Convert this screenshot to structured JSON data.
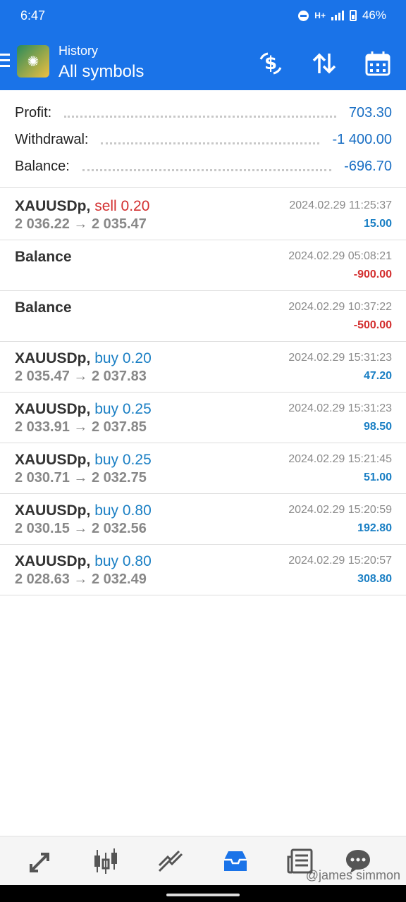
{
  "status": {
    "time": "6:47",
    "network": "H+",
    "battery": "46%"
  },
  "header": {
    "subtitle": "History",
    "title": "All symbols"
  },
  "summary": {
    "profit_label": "Profit:",
    "profit_value": "703.30",
    "withdrawal_label": "Withdrawal:",
    "withdrawal_value": "-1 400.00",
    "balance_label": "Balance:",
    "balance_value": "-696.70"
  },
  "rows": [
    {
      "symbol": "XAUUSDp,",
      "type": "sell 0.20",
      "prices": "2 036.22 → 2 035.47",
      "time": "2024.02.29 11:25:37",
      "amount": "15.00"
    },
    {
      "symbol": "Balance",
      "type": "",
      "prices": "",
      "time": "2024.02.29 05:08:21",
      "amount": "-900.00"
    },
    {
      "symbol": "Balance",
      "type": "",
      "prices": "",
      "time": "2024.02.29 10:37:22",
      "amount": "-500.00"
    },
    {
      "symbol": "XAUUSDp,",
      "type": "buy 0.20",
      "prices": "2 035.47 → 2 037.83",
      "time": "2024.02.29 15:31:23",
      "amount": "47.20"
    },
    {
      "symbol": "XAUUSDp,",
      "type": "buy 0.25",
      "prices": "2 033.91 → 2 037.85",
      "time": "2024.02.29 15:31:23",
      "amount": "98.50"
    },
    {
      "symbol": "XAUUSDp,",
      "type": "buy 0.25",
      "prices": "2 030.71 → 2 032.75",
      "time": "2024.02.29 15:21:45",
      "amount": "51.00"
    },
    {
      "symbol": "XAUUSDp,",
      "type": "buy 0.80",
      "prices": "2 030.15 → 2 032.56",
      "time": "2024.02.29 15:20:59",
      "amount": "192.80"
    },
    {
      "symbol": "XAUUSDp,",
      "type": "buy 0.80",
      "prices": "2 028.63 → 2 032.49",
      "time": "2024.02.29 15:20:57",
      "amount": "308.80"
    }
  ],
  "nav": [
    "quotes-icon",
    "chart-icon",
    "trade-icon",
    "history-icon",
    "news-icon",
    "chat-icon"
  ],
  "watermark": "@james simmon",
  "colors": {
    "accent": "#1a73e8",
    "positive": "#1a7fc4",
    "negative": "#d32f2f"
  }
}
